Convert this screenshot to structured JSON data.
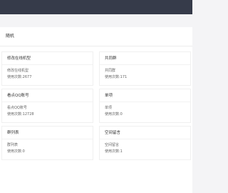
{
  "section": {
    "title": "随机"
  },
  "cards": [
    {
      "name": "修改在线机型",
      "desc": "修改在线机型",
      "usage": "使用次数:2677"
    },
    {
      "name": "共同群",
      "desc": "共同群",
      "usage": "使用次数:171"
    },
    {
      "name": "看点QQ账号",
      "desc": "看点QQ账号",
      "usage": "使用次数:12728"
    },
    {
      "name": "单项",
      "desc": "单项",
      "usage": "使用次数:0"
    },
    {
      "name": "群列表",
      "desc": "群列表",
      "usage": "使用次数:0"
    },
    {
      "name": "空间留言",
      "desc": "空间留言",
      "usage": "使用次数:1"
    }
  ]
}
